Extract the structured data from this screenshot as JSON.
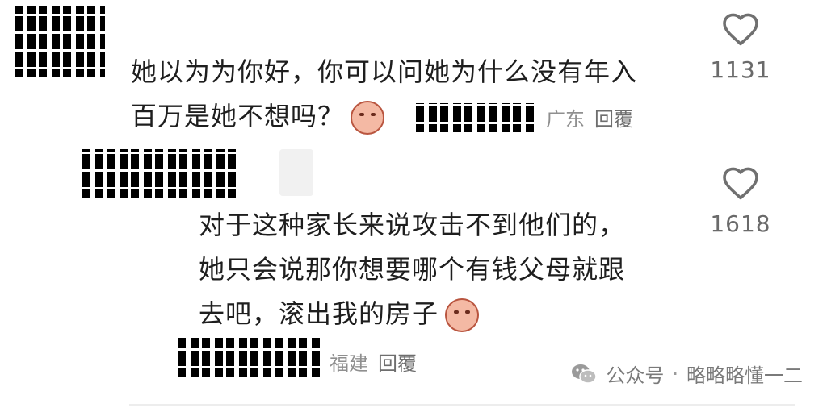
{
  "comments": [
    {
      "text_lines": [
        "她以为为你好，你可以问她为什么没有年入",
        "百万是她不想吗？"
      ],
      "location": "广东",
      "reply_label": "回覆",
      "likes": "1131"
    },
    {
      "text_lines": [
        "对于这种家长来说攻击不到他们的，",
        "她只会说那你想要哪个有钱父母就跟",
        "去吧，滚出我的房子"
      ],
      "location": "福建",
      "reply_label": "回覆",
      "likes": "1618"
    }
  ],
  "icons": {
    "like": "heart-outline-icon",
    "emoji": "crying-face-emoji",
    "watermark": "wechat-icon"
  },
  "watermark": {
    "prefix": "公众号",
    "separator": "·",
    "account": "略略略懂一二"
  },
  "colors": {
    "text": "#1e1e1e",
    "meta": "#8f8f8f",
    "heart": "#707070"
  }
}
